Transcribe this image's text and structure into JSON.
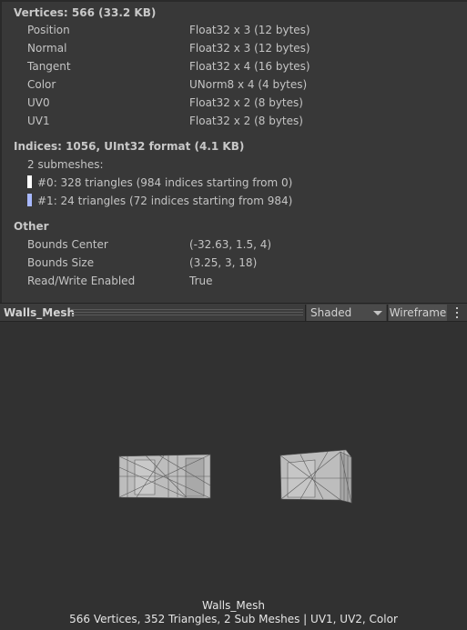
{
  "vertices": {
    "header": "Vertices: 566 (33.2 KB)",
    "attributes": [
      {
        "name": "Position",
        "format": "Float32 x 3 (12 bytes)"
      },
      {
        "name": "Normal",
        "format": "Float32 x 3 (12 bytes)"
      },
      {
        "name": "Tangent",
        "format": "Float32 x 4 (16 bytes)"
      },
      {
        "name": "Color",
        "format": "UNorm8 x 4 (4 bytes)"
      },
      {
        "name": "UV0",
        "format": "Float32 x 2 (8 bytes)"
      },
      {
        "name": "UV1",
        "format": "Float32 x 2 (8 bytes)"
      }
    ]
  },
  "indices": {
    "header": "Indices: 1056, UInt32 format (4.1 KB)",
    "submesh_count": "2 submeshes:",
    "submeshes": [
      {
        "label": "#0: 328 triangles (984 indices starting from 0)",
        "color": "#ffffff"
      },
      {
        "label": "#1: 24 triangles (72 indices starting from 984)",
        "color": "#a8b8ff"
      }
    ]
  },
  "other": {
    "header": "Other",
    "items": [
      {
        "name": "Bounds Center",
        "value": "(-32.63, 1.5, 4)"
      },
      {
        "name": "Bounds Size",
        "value": "(3.25, 3, 18)"
      },
      {
        "name": "Read/Write Enabled",
        "value": "True"
      }
    ]
  },
  "toolbar": {
    "title": "Walls_Mesh",
    "shading_mode": "Shaded",
    "wireframe_label": "Wireframe"
  },
  "preview": {
    "mesh_name": "Walls_Mesh",
    "stats": "566 Vertices, 352 Triangles, 2 Sub Meshes | UV1, UV2, Color"
  },
  "colors": {
    "panel_bg": "#383838",
    "preview_bg": "#313131",
    "mesh_fill": "#bdbdbd",
    "mesh_wire": "#555555"
  }
}
